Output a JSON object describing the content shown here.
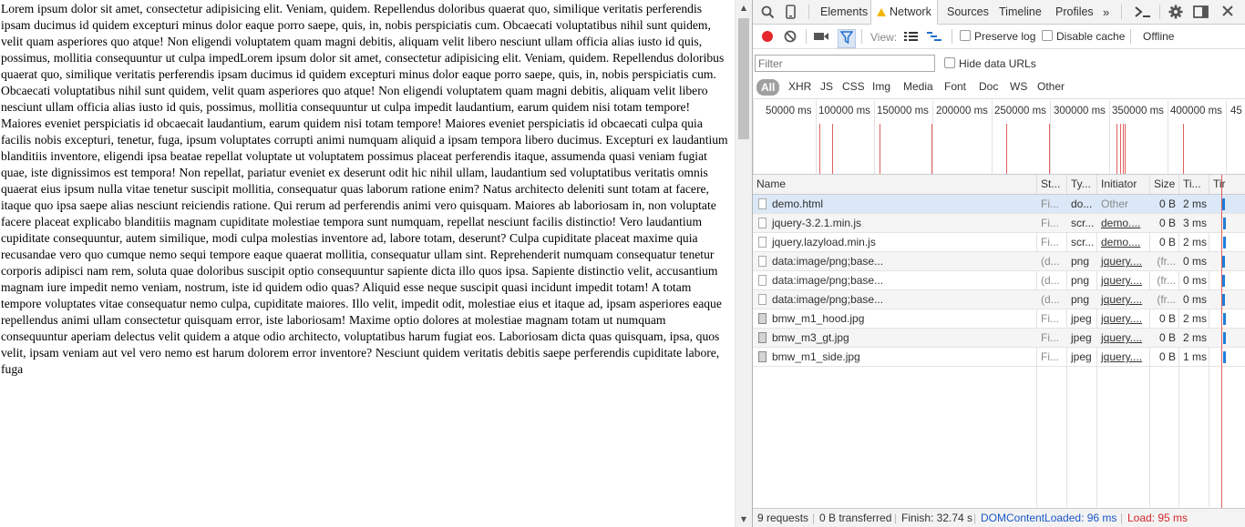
{
  "page": {
    "text": "Lorem ipsum dolor sit amet, consectetur adipisicing elit. Veniam, quidem. Repellendus doloribus quaerat quo, similique veritatis perferendis ipsam ducimus id quidem excepturi minus dolor eaque porro saepe, quis, in, nobis perspiciatis cum. Obcaecati voluptatibus nihil sunt quidem, velit quam asperiores quo atque! Non eligendi voluptatem quam magni debitis, aliquam velit libero nesciunt ullam officia alias iusto id quis, possimus, mollitia consequuntur ut culpa impedLorem ipsum dolor sit amet, consectetur adipisicing elit. Veniam, quidem. Repellendus doloribus quaerat quo, similique veritatis perferendis ipsam ducimus id quidem excepturi minus dolor eaque porro saepe, quis, in, nobis perspiciatis cum. Obcaecati voluptatibus nihil sunt quidem, velit quam asperiores quo atque! Non eligendi voluptatem quam magni debitis, aliquam velit libero nesciunt ullam officia alias iusto id quis, possimus, mollitia consequuntur ut culpa impedit laudantium, earum quidem nisi totam tempore! Maiores eveniet perspiciatis id obcaecait laudantium, earum quidem nisi totam tempore! Maiores eveniet perspiciatis id obcaecati culpa quia facilis nobis excepturi, tenetur, fuga, ipsum voluptates corrupti animi numquam aliquid a ipsam tempora libero ducimus. Excepturi ex laudantium blanditiis inventore, eligendi ipsa beatae repellat voluptate ut voluptatem possimus placeat perferendis itaque, assumenda quasi veniam fugiat quae, iste dignissimos est tempora! Non repellat, pariatur eveniet ex deserunt odit hic nihil ullam, laudantium sed voluptatibus veritatis omnis quaerat eius ipsum nulla vitae tenetur suscipit mollitia, consequatur quas laborum ratione enim? Natus architecto deleniti sunt totam at facere, itaque quo ipsa saepe alias nesciunt reiciendis ratione. Qui rerum ad perferendis animi vero quisquam. Maiores ab laboriosam in, non voluptate facere placeat explicabo blanditiis magnam cupiditate molestiae tempora sunt numquam, repellat nesciunt facilis distinctio! Vero laudantium cupiditate consequuntur, autem similique, modi culpa molestias inventore ad, labore totam, deserunt? Culpa cupiditate placeat maxime quia recusandae vero quo cumque nemo sequi tempore eaque quaerat mollitia, consequatur ullam sint. Reprehenderit numquam consequatur tenetur corporis adipisci nam rem, soluta quae doloribus suscipit optio consequuntur sapiente dicta illo quos ipsa. Sapiente distinctio velit, accusantium magnam iure impedit nemo veniam, nostrum, iste id quidem odio quas? Aliquid esse neque suscipit quasi incidunt impedit totam! A totam tempore voluptates vitae consequatur nemo culpa, cupiditate maiores. Illo velit, impedit odit, molestiae eius et itaque ad, ipsam asperiores eaque repellendus animi ullam consectetur quisquam error, iste laboriosam! Maxime optio dolores at molestiae magnam totam ut numquam consequuntur aperiam delectus velit quidem a atque odio architecto, voluptatibus harum fugiat eos. Laboriosam dicta quas quisquam, ipsa, quos velit, ipsam veniam aut vel vero nemo est harum dolorem error inventore? Nesciunt quidem veritatis debitis saepe perferendis cupiditate labore, fuga"
  },
  "devtools": {
    "tabs": [
      "Elements",
      "Network",
      "Sources",
      "Timeline",
      "Profiles"
    ],
    "more_tabs": "»",
    "toolbar": {
      "view_label": "View:",
      "preserve_log": "Preserve log",
      "disable_cache": "Disable cache",
      "offline": "Offline"
    },
    "filter": {
      "placeholder": "Filter",
      "hide_data_urls": "Hide data URLs"
    },
    "types": [
      "All",
      "XHR",
      "JS",
      "CSS",
      "Img",
      "Media",
      "Font",
      "Doc",
      "WS",
      "Other"
    ],
    "overview_labels": [
      "50000 ms",
      "100000 ms",
      "150000 ms",
      "200000 ms",
      "250000 ms",
      "300000 ms",
      "350000 ms",
      "400000 ms",
      "45"
    ],
    "columns": [
      "Name",
      "St...",
      "Ty...",
      "Initiator",
      "Size",
      "Ti...",
      "Tir"
    ],
    "requests": [
      {
        "name": "demo.html",
        "status": "Fi...",
        "type": "do...",
        "initiator": "Other",
        "size": "0 B",
        "time": "2 ms",
        "icon": "document-icon"
      },
      {
        "name": "jquery-3.2.1.min.js",
        "status": "Fi...",
        "type": "scr...",
        "initiator": "demo....",
        "size": "0 B",
        "time": "3 ms",
        "icon": "document-icon"
      },
      {
        "name": "jquery.lazyload.min.js",
        "status": "Fi...",
        "type": "scr...",
        "initiator": "demo....",
        "size": "0 B",
        "time": "2 ms",
        "icon": "document-icon"
      },
      {
        "name": "data:image/png;base...",
        "status": "(d...",
        "type": "png",
        "initiator": "jquery....",
        "size": "(fr...",
        "time": "0 ms",
        "icon": "document-icon"
      },
      {
        "name": "data:image/png;base...",
        "status": "(d...",
        "type": "png",
        "initiator": "jquery....",
        "size": "(fr...",
        "time": "0 ms",
        "icon": "document-icon"
      },
      {
        "name": "data:image/png;base...",
        "status": "(d...",
        "type": "png",
        "initiator": "jquery....",
        "size": "(fr...",
        "time": "0 ms",
        "icon": "document-icon"
      },
      {
        "name": "bmw_m1_hood.jpg",
        "status": "Fi...",
        "type": "jpeg",
        "initiator": "jquery....",
        "size": "0 B",
        "time": "2 ms",
        "icon": "image-icon"
      },
      {
        "name": "bmw_m3_gt.jpg",
        "status": "Fi...",
        "type": "jpeg",
        "initiator": "jquery....",
        "size": "0 B",
        "time": "2 ms",
        "icon": "image-icon"
      },
      {
        "name": "bmw_m1_side.jpg",
        "status": "Fi...",
        "type": "jpeg",
        "initiator": "jquery....",
        "size": "0 B",
        "time": "1 ms",
        "icon": "image-icon"
      }
    ],
    "status": {
      "requests": "9 requests",
      "transferred": "0 B transferred",
      "finish": "Finish: 32.74 s",
      "dom_loaded": "DOMContentLoaded: 96 ms",
      "load": "Load: 95 ms"
    },
    "colors": {
      "dom_loaded": "#1a57c6",
      "load": "#d0262a",
      "record": "#e5262c",
      "waterfall": "#1f7fd8"
    }
  }
}
